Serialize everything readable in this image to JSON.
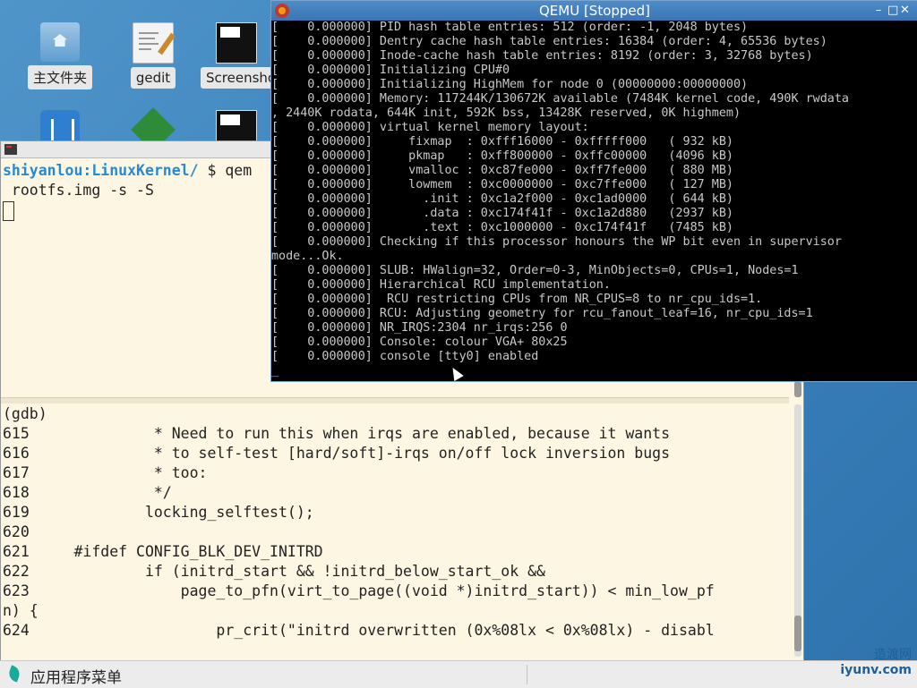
{
  "desktop": {
    "icons": [
      {
        "label": "主文件夹",
        "icon": "folder-home-icon"
      },
      {
        "label": "gedit",
        "icon": "text-editor-icon"
      },
      {
        "label": "Screensho",
        "icon": "screenshot-icon"
      }
    ]
  },
  "terminal": {
    "prompt_user": "shiyanlou",
    "prompt_path": ":LinuxKernel/",
    "prompt_symbol": " $ ",
    "command_start": "qem",
    "command_cont": " rootfs.img -s -S",
    "gdb_prompt": "(gdb)",
    "source_lines": [
      "615              * Need to run this when irqs are enabled, because it wants",
      "616              * to self-test [hard/soft]-irqs on/off lock inversion bugs",
      "617              * too:",
      "618              */",
      "619             locking_selftest();",
      "620",
      "621     #ifdef CONFIG_BLK_DEV_INITRD",
      "622             if (initrd_start && !initrd_below_start_ok &&",
      "623                 page_to_pfn(virt_to_page((void *)initrd_start)) < min_low_pf",
      "n) {",
      "624                     pr_crit(\"initrd overwritten (0x%08lx < 0x%08lx) - disabl"
    ]
  },
  "qemu": {
    "title": "QEMU [Stopped]",
    "console_lines": [
      "[    0.000000] PID hash table entries: 512 (order: -1, 2048 bytes)",
      "[    0.000000] Dentry cache hash table entries: 16384 (order: 4, 65536 bytes)",
      "[    0.000000] Inode-cache hash table entries: 8192 (order: 3, 32768 bytes)",
      "[    0.000000] Initializing CPU#0",
      "[    0.000000] Initializing HighMem for node 0 (00000000:00000000)",
      "[    0.000000] Memory: 117244K/130672K available (7484K kernel code, 490K rwdata",
      ", 2440K rodata, 644K init, 592K bss, 13428K reserved, 0K highmem)",
      "[    0.000000] virtual kernel memory layout:",
      "[    0.000000]     fixmap  : 0xfff16000 - 0xfffff000   ( 932 kB)",
      "[    0.000000]     pkmap   : 0xff800000 - 0xffc00000   (4096 kB)",
      "[    0.000000]     vmalloc : 0xc87fe000 - 0xff7fe000   ( 880 MB)",
      "[    0.000000]     lowmem  : 0xc0000000 - 0xc7ffe000   ( 127 MB)",
      "[    0.000000]       .init : 0xc1a2f000 - 0xc1ad0000   ( 644 kB)",
      "[    0.000000]       .data : 0xc174f41f - 0xc1a2d880   (2937 kB)",
      "[    0.000000]       .text : 0xc1000000 - 0xc174f41f   (7485 kB)",
      "[    0.000000] Checking if this processor honours the WP bit even in supervisor",
      "mode...Ok.",
      "[    0.000000] SLUB: HWalign=32, Order=0-3, MinObjects=0, CPUs=1, Nodes=1",
      "[    0.000000] Hierarchical RCU implementation.",
      "[    0.000000] \tRCU restricting CPUs from NR_CPUS=8 to nr_cpu_ids=1.",
      "[    0.000000] RCU: Adjusting geometry for rcu_fanout_leaf=16, nr_cpu_ids=1",
      "[    0.000000] NR_IRQS:2304 nr_irqs:256 0",
      "[    0.000000] Console: colour VGA+ 80x25",
      "[    0.000000] console [tty0] enabled",
      "_"
    ]
  },
  "taskbar": {
    "menu_label": "应用程序菜单",
    "watermark_top": "造渡网",
    "watermark_bottom": "iyunv.com"
  }
}
